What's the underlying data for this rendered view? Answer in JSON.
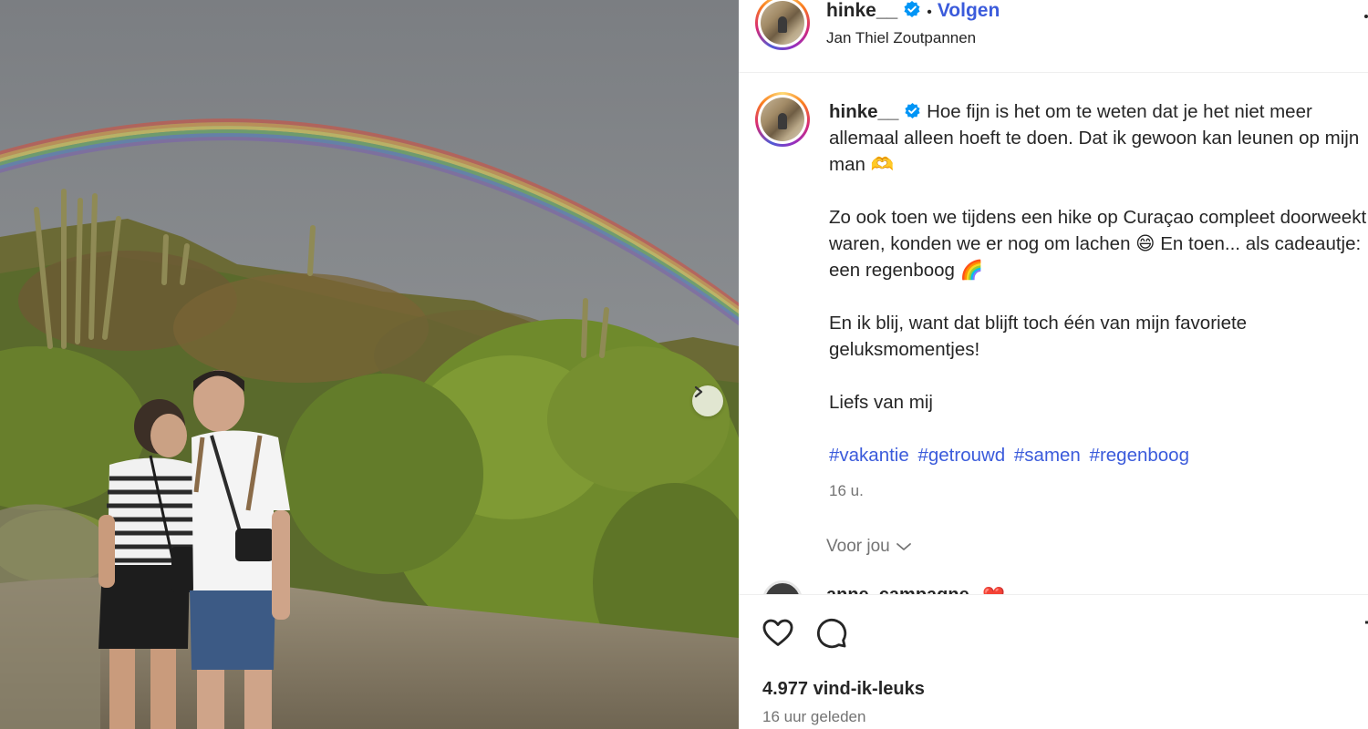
{
  "post": {
    "username": "hinke__",
    "follow_label": "Volgen",
    "separator": "•",
    "location": "Jan Thiel Zoutpannen",
    "caption": {
      "username": "hinke__",
      "line1": "Hoe fijn is het om te weten dat je het niet meer allemaal alleen hoeft te doen. Dat ik gewoon kan leunen op mijn man 🫶",
      "line2": "Zo ook toen we tijdens een hike op Curaçao compleet doorweekt waren, konden we er nog om lachen 😄 En toen... als cadeautje: een regenboog 🌈",
      "line3": "En ik blij, want dat blijft toch één van mijn favoriete geluksmomentjes!",
      "line4": "Liefs van mij",
      "hashtags": [
        "#vakantie",
        "#getrouwd",
        "#samen",
        "#regenboog"
      ],
      "time": "16 u."
    },
    "for_you_label": "Voor jou",
    "comment_preview": {
      "username": "anne_campagne",
      "emoji": "❤️"
    },
    "likes": "4.977 vind-ik-leuks",
    "posted_ago": "16 uur geleden"
  },
  "icons": {
    "verified": "verified-badge-icon",
    "like": "heart-icon",
    "comment": "comment-icon",
    "save": "bookmark-icon",
    "next": "chevron-right-icon",
    "more": "more-options-icon",
    "for_you_chevron": "chevron-down-icon"
  },
  "colors": {
    "link_blue": "#3b5bdb",
    "verified_blue": "#0095f6",
    "muted_text": "#737373"
  }
}
